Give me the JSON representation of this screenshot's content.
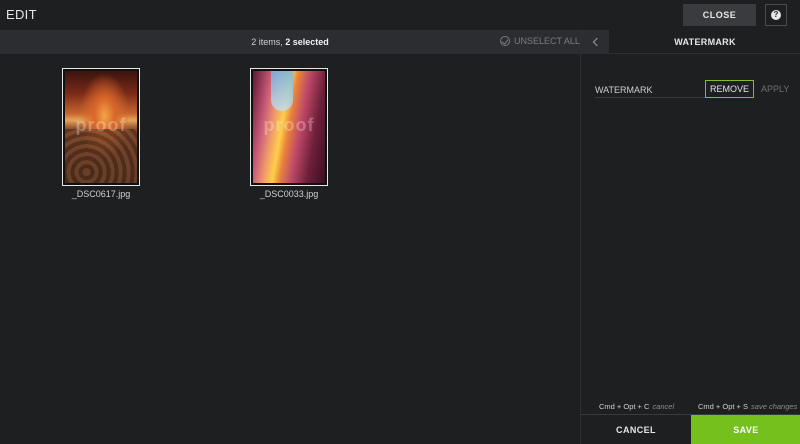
{
  "header": {
    "title": "EDIT",
    "close_label": "CLOSE",
    "help_icon": "help-icon",
    "help_glyph": "?"
  },
  "selection": {
    "count_text": "2 items,",
    "selected_text": "2 selected",
    "unselect_label": "UNSELECT ALL"
  },
  "files": [
    {
      "name": "_DSC0617.jpg",
      "watermark": "proof"
    },
    {
      "name": "_DSC0033.jpg",
      "watermark": "proof"
    }
  ],
  "panel": {
    "title": "WATERMARK",
    "watermark_label": "WATERMARK",
    "remove_label": "REMOVE",
    "apply_label": "APPLY",
    "shortcut_cancel_keys": "Cmd + Opt + C",
    "shortcut_cancel_hint": "cancel",
    "shortcut_save_keys": "Cmd + Opt + S",
    "shortcut_save_hint": "save changes",
    "cancel_label": "CANCEL",
    "save_label": "SAVE"
  },
  "colors": {
    "accent": "#76c01e",
    "background": "#1e1f21",
    "bar": "#2c2d30"
  }
}
